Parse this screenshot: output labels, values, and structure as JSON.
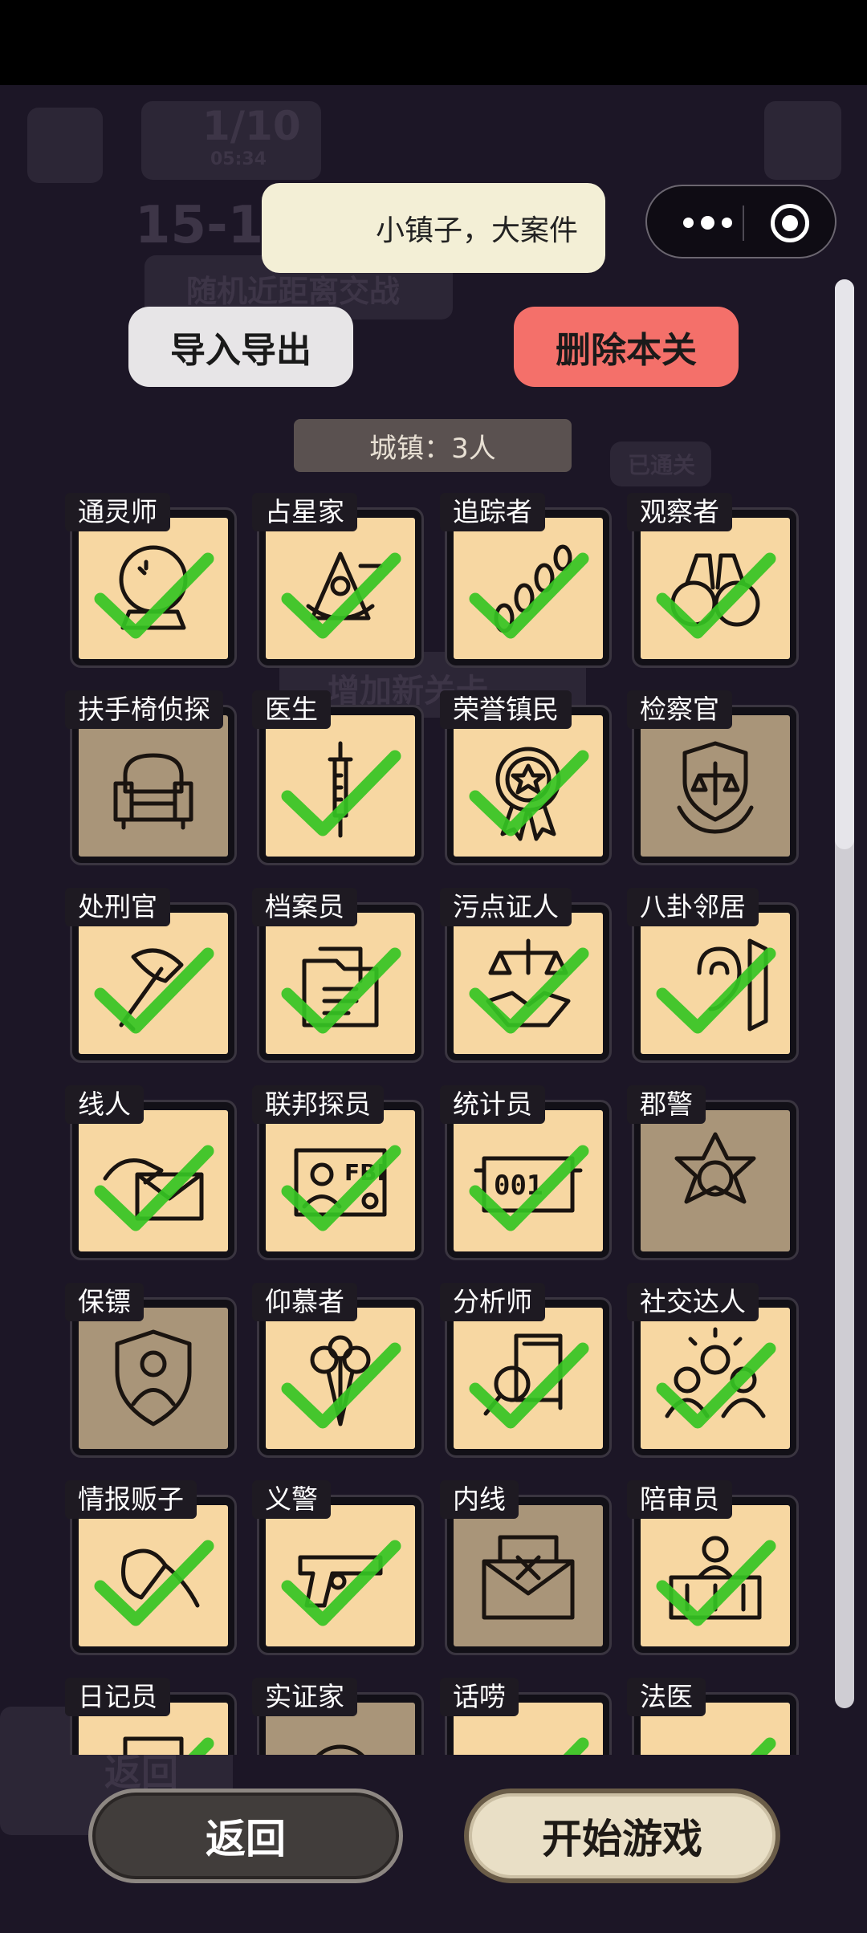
{
  "toast": {
    "text": "小镇子，大案件"
  },
  "buttons": {
    "import_export": "导入导出",
    "delete_level": "删除本关",
    "back": "返回",
    "start": "开始游戏"
  },
  "town_tag": "城镇：3人",
  "background": {
    "energy": "1/10",
    "timer": "05:34",
    "level_id": "15-1",
    "level_name": "随机近距离交战",
    "passed_badge": "已通关",
    "add_level": "增加新关卡",
    "footer_back": "返回"
  },
  "roles": [
    {
      "name": "通灵师",
      "icon": "crystal-ball-icon",
      "selected": true
    },
    {
      "name": "占星家",
      "icon": "sextant-icon",
      "selected": true
    },
    {
      "name": "追踪者",
      "icon": "footprints-icon",
      "selected": true
    },
    {
      "name": "观察者",
      "icon": "binoculars-icon",
      "selected": true
    },
    {
      "name": "扶手椅侦探",
      "icon": "armchair-icon",
      "selected": false
    },
    {
      "name": "医生",
      "icon": "syringe-icon",
      "selected": true
    },
    {
      "name": "荣誉镇民",
      "icon": "medal-icon",
      "selected": true
    },
    {
      "name": "检察官",
      "icon": "justice-emblem-icon",
      "selected": false
    },
    {
      "name": "处刑官",
      "icon": "axe-icon",
      "selected": true
    },
    {
      "name": "档案员",
      "icon": "folder-icon",
      "selected": true
    },
    {
      "name": "污点证人",
      "icon": "scales-handshake-icon",
      "selected": true
    },
    {
      "name": "八卦邻居",
      "icon": "ear-wall-icon",
      "selected": true
    },
    {
      "name": "线人",
      "icon": "envelope-hand-icon",
      "selected": true
    },
    {
      "name": "联邦探员",
      "icon": "fbi-badge-icon",
      "selected": true
    },
    {
      "name": "统计员",
      "icon": "counter-icon",
      "selected": true
    },
    {
      "name": "郡警",
      "icon": "sheriff-star-icon",
      "selected": false
    },
    {
      "name": "保镖",
      "icon": "shield-person-icon",
      "selected": false
    },
    {
      "name": "仰慕者",
      "icon": "roses-icon",
      "selected": true
    },
    {
      "name": "分析师",
      "icon": "magnifier-docs-icon",
      "selected": true
    },
    {
      "name": "社交达人",
      "icon": "group-sun-icon",
      "selected": true
    },
    {
      "name": "情报贩子",
      "icon": "whisper-hands-icon",
      "selected": true
    },
    {
      "name": "义警",
      "icon": "pistol-icon",
      "selected": true
    },
    {
      "name": "内线",
      "icon": "envelope-x-icon",
      "selected": false
    },
    {
      "name": "陪审员",
      "icon": "jury-box-icon",
      "selected": true
    },
    {
      "name": "日记员",
      "icon": "diary-icon",
      "selected": true
    },
    {
      "name": "实证家",
      "icon": "empiricist-icon",
      "selected": false
    },
    {
      "name": "话唠",
      "icon": "lips-icon",
      "selected": true
    },
    {
      "name": "法医",
      "icon": "coroner-icon",
      "selected": true
    }
  ],
  "colors": {
    "card_face": "#f7d7a2",
    "card_face_off": "#a99579",
    "check": "#35c423",
    "delete": "#f4706a"
  }
}
